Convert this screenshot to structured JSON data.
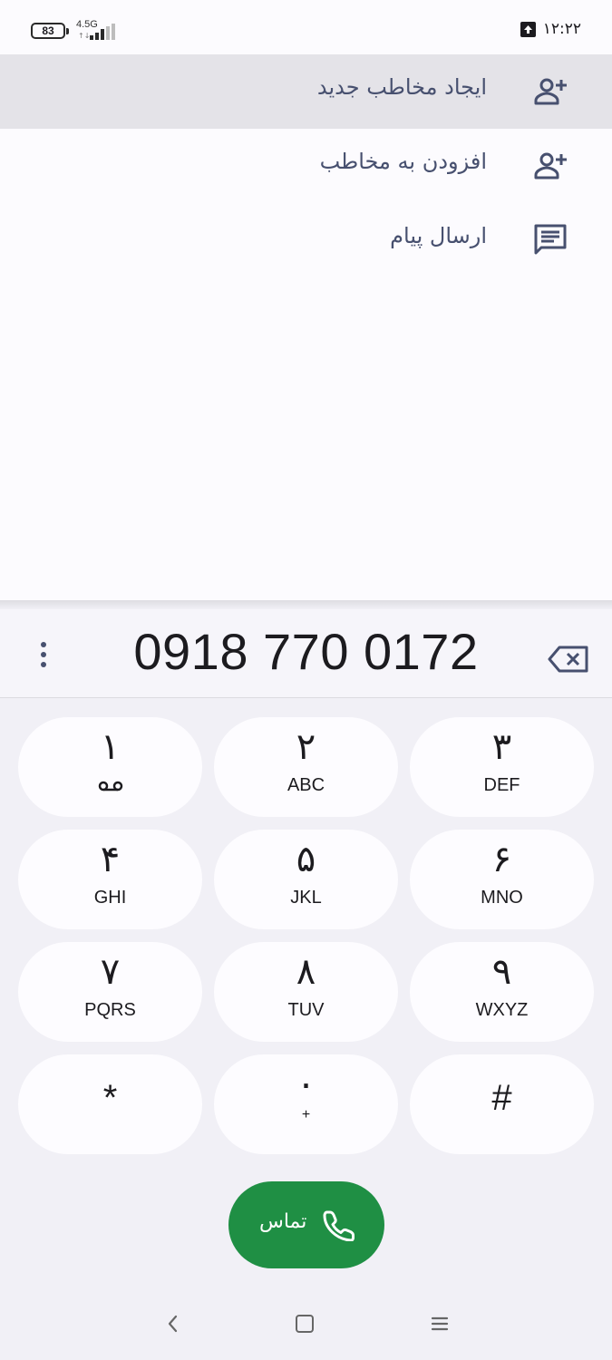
{
  "status_bar": {
    "battery_level": "83",
    "network_type": "4.5G",
    "network_arrows": "↑↓",
    "time": "۱۲:۲۲"
  },
  "actions": [
    {
      "label": "ایجاد مخاطب جدید",
      "icon": "add-contact-icon",
      "highlighted": true
    },
    {
      "label": "افزودن به مخاطب",
      "icon": "add-contact-icon",
      "highlighted": false
    },
    {
      "label": "ارسال پیام",
      "icon": "message-icon",
      "highlighted": false
    }
  ],
  "dialer": {
    "number": "0918 770 0172",
    "keys": [
      {
        "digit": "۱",
        "letters": "",
        "icon": "voicemail-icon"
      },
      {
        "digit": "۲",
        "letters": "ABC"
      },
      {
        "digit": "۳",
        "letters": "DEF"
      },
      {
        "digit": "۴",
        "letters": "GHI"
      },
      {
        "digit": "۵",
        "letters": "JKL"
      },
      {
        "digit": "۶",
        "letters": "MNO"
      },
      {
        "digit": "۷",
        "letters": "PQRS"
      },
      {
        "digit": "۸",
        "letters": "TUV"
      },
      {
        "digit": "۹",
        "letters": "WXYZ"
      },
      {
        "digit": "*",
        "letters": ""
      },
      {
        "digit": "۰",
        "letters": "+"
      },
      {
        "digit": "#",
        "letters": ""
      }
    ],
    "call_label": "تماس",
    "call_color": "#1f8f44"
  }
}
